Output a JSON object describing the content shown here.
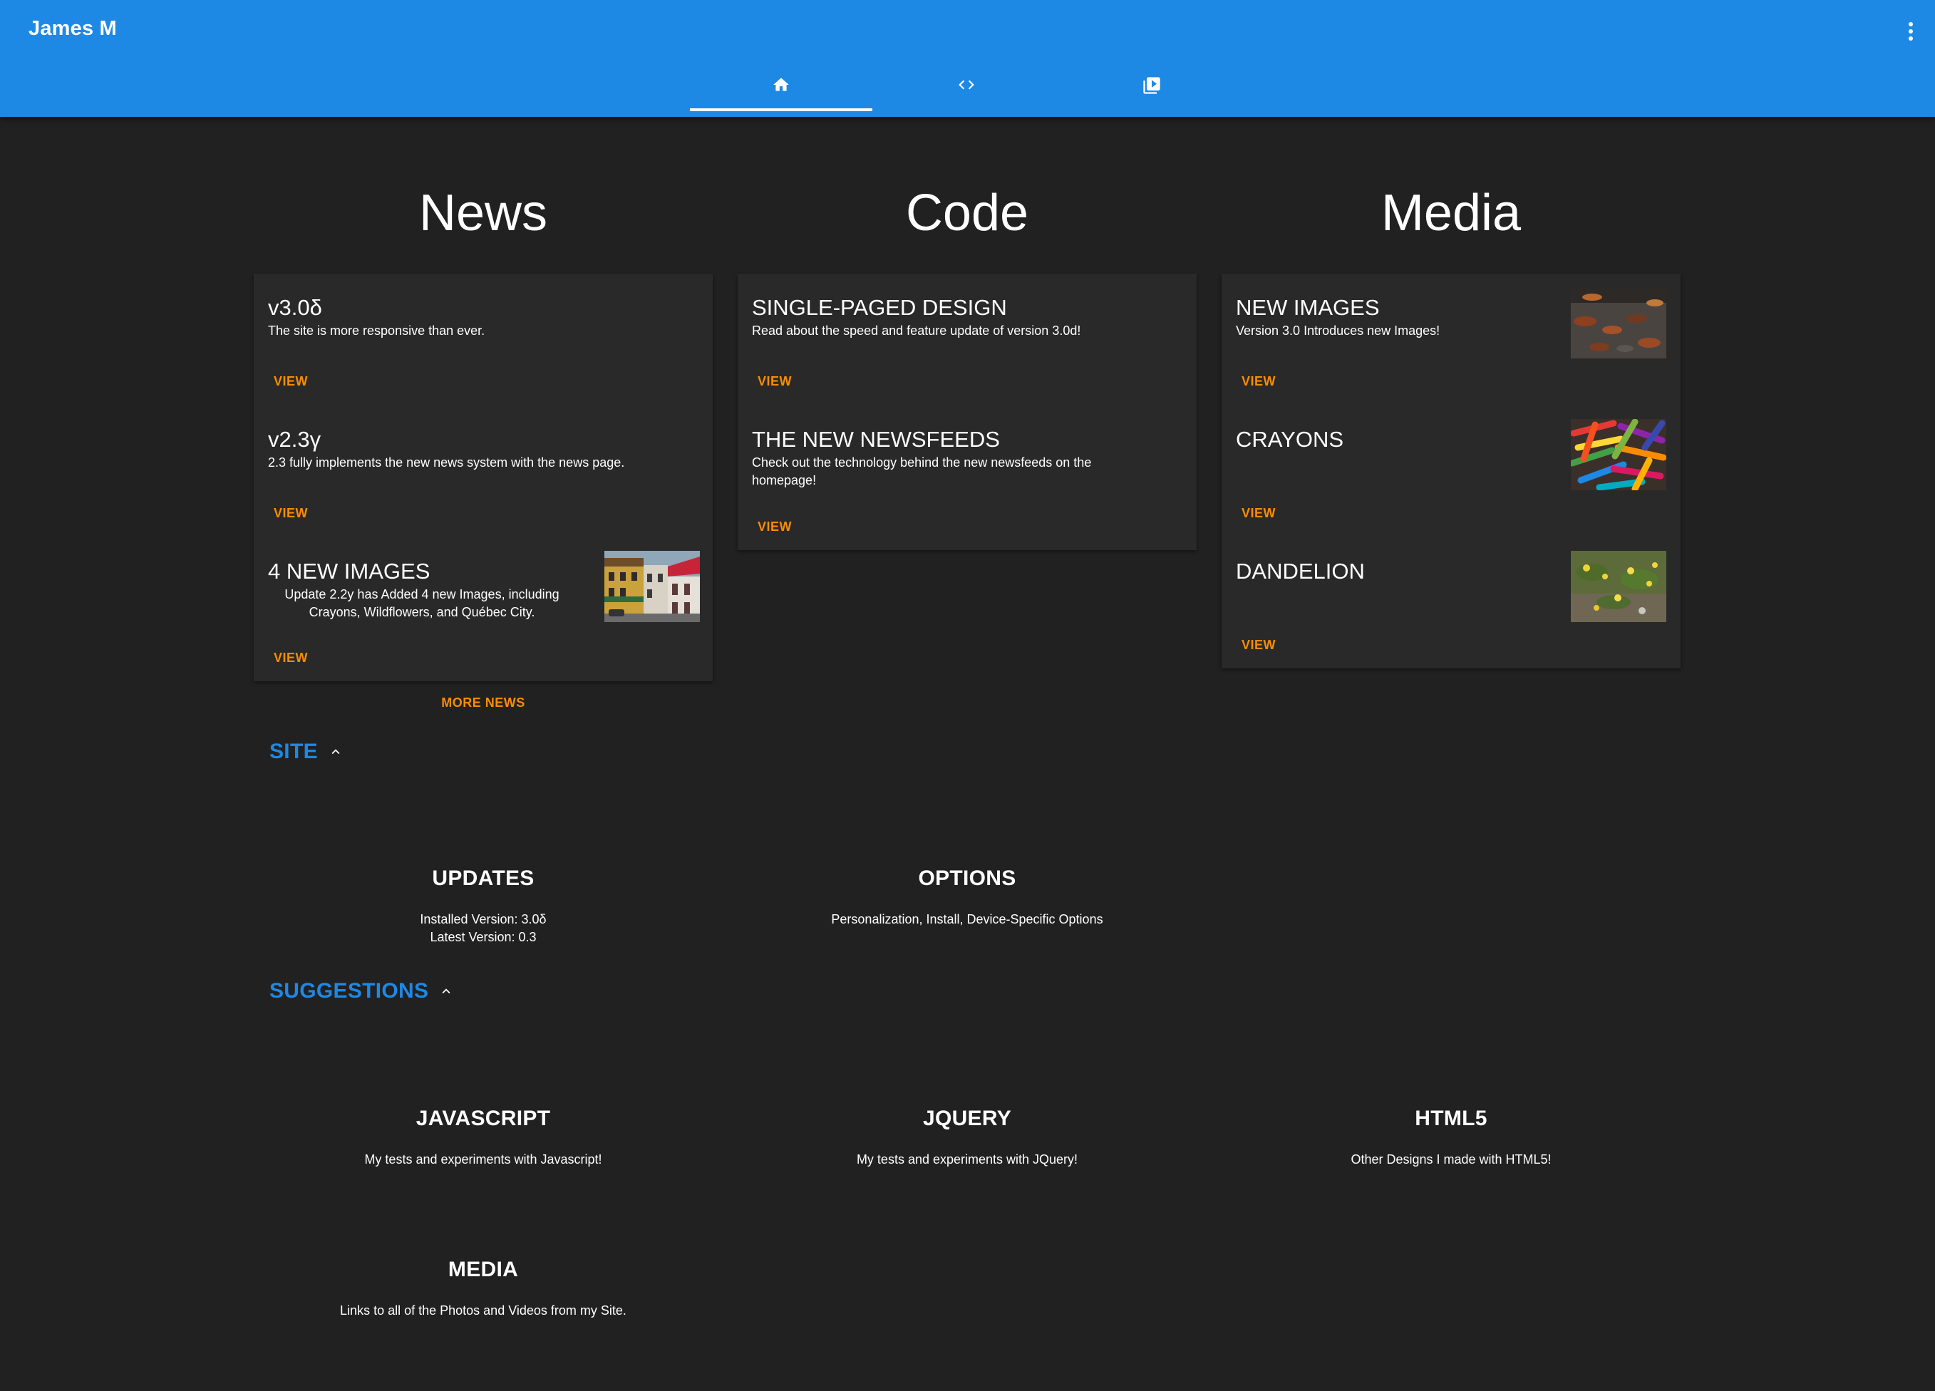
{
  "app": {
    "title": "James M"
  },
  "tabs": [
    {
      "icon": "home-icon",
      "selected": true
    },
    {
      "icon": "code-icon",
      "selected": false
    },
    {
      "icon": "video-library-icon",
      "selected": false
    }
  ],
  "columns": {
    "news": "News",
    "code": "Code",
    "media": "Media"
  },
  "news": {
    "items": [
      {
        "title": "v3.0δ",
        "desc": "The site is more responsive than ever.",
        "action": "VIEW"
      },
      {
        "title": "v2.3γ",
        "desc": "2.3 fully implements the new news system with the news page.",
        "action": "VIEW"
      },
      {
        "title": "4 NEW IMAGES",
        "desc": "Update 2.2y has Added 4 new Images, including Crayons, Wildflowers, and Québec City.",
        "action": "VIEW",
        "image": "quebec-city-street"
      }
    ],
    "more": "MORE NEWS"
  },
  "code": {
    "items": [
      {
        "title": "SINGLE-PAGED DESIGN",
        "desc": "Read about the speed and feature update of version 3.0d!",
        "action": "VIEW"
      },
      {
        "title": "THE NEW NEWSFEEDS",
        "desc": "Check out the technology behind the new newsfeeds on the homepage!",
        "action": "VIEW"
      }
    ]
  },
  "media": {
    "items": [
      {
        "title": "NEW IMAGES",
        "desc": "Version 3.0 Introduces new Images!",
        "action": "VIEW",
        "image": "autumn-leaves"
      },
      {
        "title": "CRAYONS",
        "action": "VIEW",
        "image": "crayons"
      },
      {
        "title": "DANDELION",
        "action": "VIEW",
        "image": "dandelions"
      }
    ]
  },
  "site": {
    "label": "SITE",
    "expanded": true,
    "links": [
      {
        "title": "UPDATES",
        "line1": "Installed Version: 3.0δ",
        "line2": "Latest Version: 0.3"
      },
      {
        "title": "OPTIONS",
        "line1": "Personalization, Install, Device-Specific Options"
      }
    ]
  },
  "suggestions": {
    "label": "SUGGESTIONS",
    "expanded": true,
    "links": [
      {
        "title": "JAVASCRIPT",
        "desc": "My tests and experiments with Javascript!"
      },
      {
        "title": "JQUERY",
        "desc": "My tests and experiments with JQuery!"
      },
      {
        "title": "HTML5",
        "desc": "Other Designs I made with HTML5!"
      },
      {
        "title": "MEDIA",
        "desc": "Links to all of the Photos and Videos from my Site."
      }
    ]
  },
  "colors": {
    "primary": "#1e88e5",
    "accent": "#fb8c00",
    "background": "#212121",
    "card": "#292929"
  }
}
